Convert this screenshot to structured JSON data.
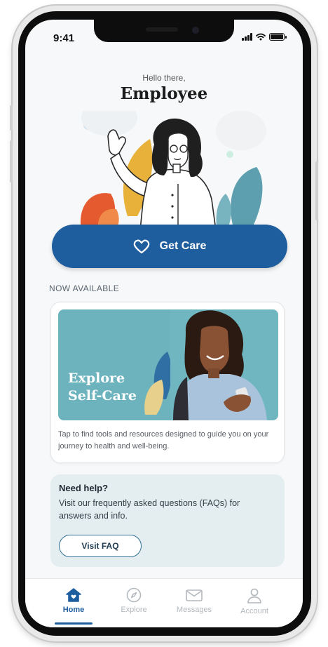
{
  "status_bar": {
    "time": "9:41"
  },
  "header": {
    "greeting": "Hello there,",
    "name": "Employee"
  },
  "primary_action": {
    "label": "Get Care",
    "icon": "heart-icon"
  },
  "now_available": {
    "section_label": "NOW AVAILABLE",
    "card": {
      "heading_line1": "Explore",
      "heading_line2": "Self-Care",
      "description": "Tap to find tools and resources designed to guide you on your journey to health and well-being."
    }
  },
  "help": {
    "title": "Need help?",
    "text": "Visit our frequently asked questions (FAQs) for answers and info.",
    "button_label": "Visit FAQ"
  },
  "tabbar": {
    "tabs": [
      {
        "label": "Home",
        "icon": "home-icon",
        "active": true
      },
      {
        "label": "Explore",
        "icon": "compass-icon",
        "active": false
      },
      {
        "label": "Messages",
        "icon": "mail-icon",
        "active": false
      },
      {
        "label": "Account",
        "icon": "user-icon",
        "active": false
      }
    ]
  },
  "colors": {
    "primary": "#1f5e9e",
    "card_teal": "#6cb3bd",
    "help_bg": "#e4eef0",
    "inactive_tab": "#b3b8bd"
  }
}
